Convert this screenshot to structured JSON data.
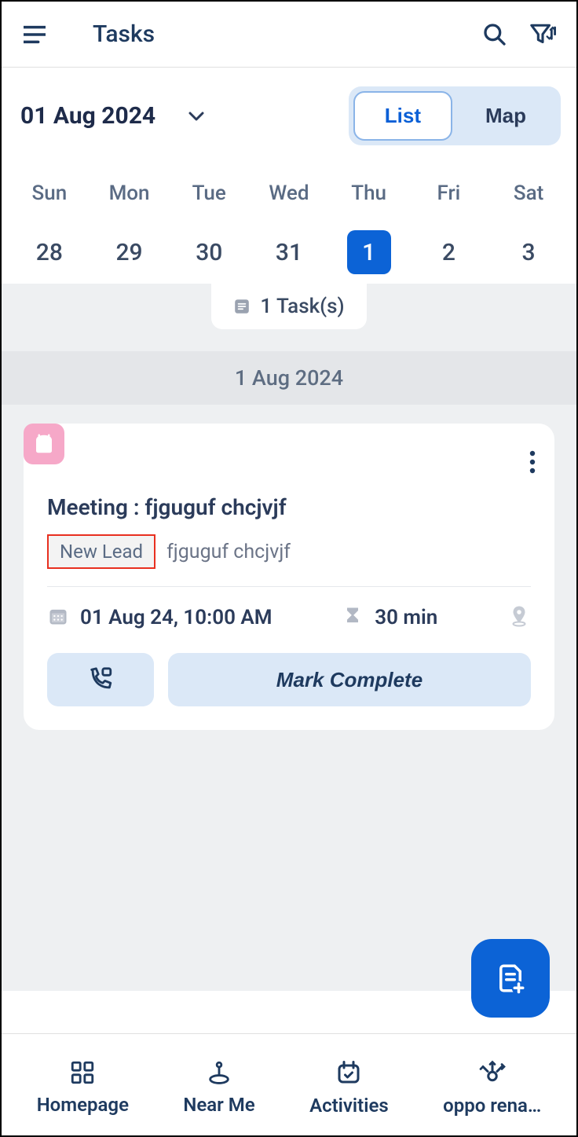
{
  "header": {
    "title": "Tasks"
  },
  "date": {
    "label": "01 Aug 2024"
  },
  "toggle": {
    "list": "List",
    "map": "Map"
  },
  "week": {
    "days": [
      {
        "name": "Sun",
        "num": "28"
      },
      {
        "name": "Mon",
        "num": "29"
      },
      {
        "name": "Tue",
        "num": "30"
      },
      {
        "name": "Wed",
        "num": "31"
      },
      {
        "name": "Thu",
        "num": "1"
      },
      {
        "name": "Fri",
        "num": "2"
      },
      {
        "name": "Sat",
        "num": "3"
      }
    ]
  },
  "tasks_count": "1 Task(s)",
  "date_band": "1 Aug 2024",
  "task": {
    "title": "Meeting : fjguguf chcjvjf",
    "badge": "New Lead",
    "subtitle": "fjguguf chcjvjf",
    "datetime": "01 Aug 24, 10:00 AM",
    "duration": "30 min",
    "complete_label": "Mark Complete"
  },
  "nav": {
    "home": "Homepage",
    "near": "Near Me",
    "activities": "Activities",
    "more": "oppo rena…"
  }
}
